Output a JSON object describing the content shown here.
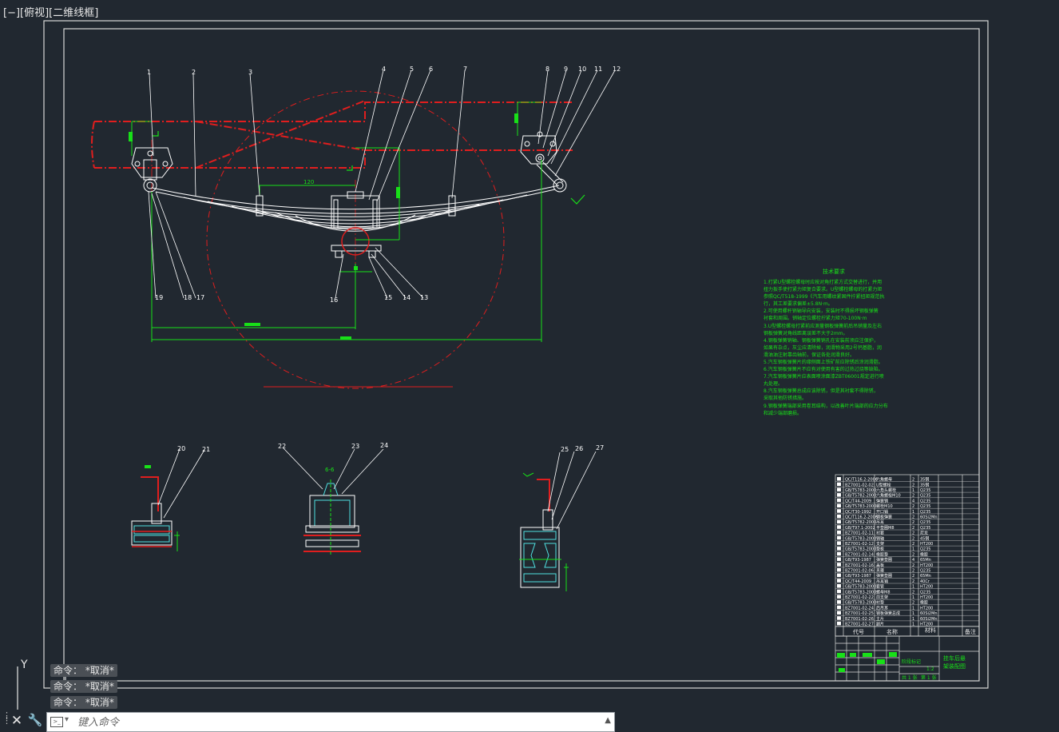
{
  "viewport": {
    "label": "[−][俯视][二维线框]"
  },
  "colors": {
    "background": "#212830",
    "red": "#e01e1e",
    "green": "#18e018",
    "white": "#ffffff",
    "cyan": "#4fe0e0",
    "frame": "#d8d8d8"
  },
  "tech_notes": {
    "title": "技术要求",
    "lines": [
      "1.打紧U型螺栓螺母时应按对角打紧方式交替进行，并用",
      "扭力扳手使打紧力矩复合要求。U型螺栓螺母的打紧力矩",
      "参照QC/T518-1999《汽车用螺纹紧固件拧紧扭矩规范执",
      "行，其工差要求偏差±5.8N·m。",
      "2.可使用螺杆销轴导向安装，安装时不得损坏钢板弹簧",
      "衬套和周围。销轴定位螺栓拧紧力矩70-100N·m",
      "3.U型螺栓螺母打紧前应测量钢板弹簧前后吊销量及左右",
      "钢板弹簧对角线距离误差不大于2mm。",
      "4.钢板弹簧销轴、钢板弹簧销孔在安装前须应注保护，",
      "如果有杂点，灰尘应清除掉，润滑物采用2号钙基脂，润",
      "滑油油注射靠齿轴前，保证各处润滑良好。",
      "5.汽车钢板弹簧片的缘侧面上铁矿前应除锈后涂润滑脂。",
      "6.汽车钢板弹簧片不应有对使用有害的过热过烧等缺陷。",
      "7.汽车钢板弹簧片应表面喷涂面漆ZBT06001规定进行喷",
      "丸处理。",
      "8.汽车钢板弹簧总成应该除锈，但是其衬套不得除锈，",
      "采取其他防锈措施。",
      "9.钢板弹簧端部采用卷耳结构，以改善叶片端部的应力分布",
      "和减少端部磨损。"
    ]
  },
  "balloons": [
    "1",
    "2",
    "3",
    "4",
    "5",
    "6",
    "7",
    "8",
    "9",
    "10",
    "11",
    "12",
    "13",
    "14",
    "15",
    "16",
    "17",
    "18",
    "19",
    "20",
    "21",
    "22",
    "23",
    "24",
    "25",
    "26",
    "27"
  ],
  "dims": {
    "d120": "120",
    "section": "6-6"
  },
  "bom": {
    "rows": [
      [
        "QC/T116.2-2006",
        "六角螺母",
        "2",
        "35钢",
        ""
      ],
      [
        "BZ7001-02-02",
        "U型螺栓",
        "2",
        "35钢",
        ""
      ],
      [
        "GB/T5783-2000",
        "六角头螺栓",
        "1",
        "Q235",
        ""
      ],
      [
        "GB/T5782-2000",
        "六角螺栓M10",
        "2",
        "Q235",
        ""
      ],
      [
        "QC/T44-2009",
        "弹簧销",
        "4",
        "Q235",
        ""
      ],
      [
        "GB/T5783-2000",
        "螺栓M10",
        "2",
        "Q235",
        ""
      ],
      [
        "QC/T30-1992",
        "开口销",
        "1",
        "Q235",
        ""
      ],
      [
        "QC/T116.2-2006",
        "钢板弹簧",
        "2",
        "60Si2Mn",
        ""
      ],
      [
        "GB/T5782-2000",
        "吊耳",
        "2",
        "Q235",
        ""
      ],
      [
        "GB/T97.1-2002",
        "平垫圈M8",
        "2",
        "Q235",
        ""
      ],
      [
        "BZ7001-02-11",
        "衬套",
        "2",
        "尼龙",
        ""
      ],
      [
        "GB/T5783-2000",
        "销轴",
        "2",
        "45钢",
        ""
      ],
      [
        "BZ7001-02-12",
        "支架",
        "2",
        "HT200",
        ""
      ],
      [
        "GB/T5783-2000",
        "垫板",
        "1",
        "Q235",
        ""
      ],
      [
        "BZ7001-02-14",
        "橡胶垫",
        "2",
        "橡胶",
        ""
      ],
      [
        "GB/T93-1987",
        "弹簧垫圈",
        "4",
        "65Mn",
        ""
      ],
      [
        "BZ7001-02-16",
        "盖板",
        "2",
        "HT200",
        ""
      ],
      [
        "BZ7001-02-06",
        "夹箍",
        "2",
        "Q235",
        ""
      ],
      [
        "GB/T93-1987",
        "弹簧垫圈",
        "2",
        "65Mn",
        ""
      ],
      [
        "QC/T44-2009",
        "吊耳销",
        "2",
        "40Cr",
        ""
      ],
      [
        "GB/T5783-2000",
        "套管",
        "1",
        "HT200",
        ""
      ],
      [
        "GB/T5783-2000",
        "螺母M8",
        "2",
        "Q235",
        ""
      ],
      [
        "BZ7001-02-22",
        "前支架",
        "1",
        "HT200",
        ""
      ],
      [
        "GB/T5783-2000",
        "衬垫",
        "2",
        "橡胶",
        ""
      ],
      [
        "BZ7001-02-24",
        "后吊耳",
        "1",
        "HT200",
        ""
      ],
      [
        "BZ7001-02-25",
        "钢板弹簧总成",
        "1",
        "60Si2Mn",
        ""
      ],
      [
        "BZ7001-02-26",
        "主片",
        "1",
        "60Si2Mn",
        ""
      ],
      [
        "BZ7001-02-27",
        "副片",
        "1",
        "HT200",
        ""
      ]
    ],
    "headers": [
      "代号",
      "名称",
      "材料",
      "备注"
    ],
    "title_block": {
      "title_l1": "挂车后悬",
      "title_l2": "架装配图",
      "mid": "阶段标记",
      "scale": "1:2",
      "sheet": "共 1 张",
      "sheet2": "第 1 张"
    }
  },
  "command_line": {
    "history": [
      "命令： *取消*",
      "命令： *取消*",
      "命令： *取消*"
    ],
    "placeholder": "键入命令"
  },
  "ucs": {
    "y": "Y"
  }
}
